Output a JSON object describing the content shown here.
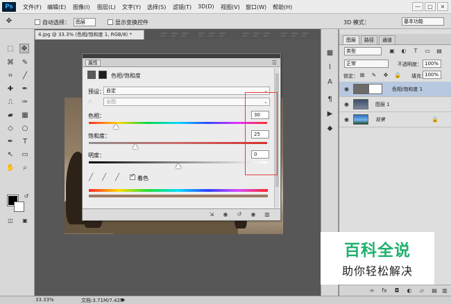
{
  "app": {
    "logo": "Ps",
    "menu": [
      "文件(F)",
      "编辑(E)",
      "图像(I)",
      "图层(L)",
      "文字(Y)",
      "选择(S)",
      "滤镜(T)",
      "3D(D)",
      "视图(V)",
      "窗口(W)",
      "帮助(H)"
    ],
    "window_buttons": [
      "—",
      "□",
      "×"
    ]
  },
  "options": {
    "auto_select_label": "自动选择：",
    "auto_select_value": "图层",
    "transform_label": "显示变换控件",
    "mode_label": "3D 模式：",
    "workspace": "基本功能"
  },
  "document": {
    "tab_title": "4.jpg @ 33.3% (色相/饱和度 1, RGB/8) *"
  },
  "properties_panel": {
    "tab_label": "属性",
    "adjustment_title": "色相/饱和度",
    "preset_label": "预设：",
    "preset_value": "自定",
    "channel_value": "全图",
    "hue_label": "色相：",
    "hue_value": "30",
    "saturation_label": "饱和度：",
    "saturation_value": "25",
    "lightness_label": "明度：",
    "lightness_value": "0",
    "colorize_label": "着色",
    "hue_slider_percent": 0.15,
    "saturation_slider_percent": 0.26,
    "lightness_slider_percent": 0.5
  },
  "layers_panel": {
    "tabs": [
      "图层",
      "路径",
      "通道"
    ],
    "kind": "类型",
    "blend_mode": "正常",
    "opacity_label": "不透明度：",
    "opacity_value": "100%",
    "lock_label": "锁定：",
    "fill_label": "填充：",
    "fill_value": "100%",
    "layers": [
      {
        "name": "色相/饱和度 1"
      },
      {
        "name": "图层 1"
      },
      {
        "name": "背景"
      }
    ]
  },
  "status": {
    "zoom": "33.33%",
    "doc_size": "文档:3.71M/7.42M"
  },
  "watermark": {
    "main": "百科全说",
    "sub": "助你轻松解决"
  },
  "colors": {
    "accent": "#31a8ff",
    "selected_layer": "#b8c8e0",
    "annotation": "#e43b3b",
    "watermark_green": "#20b16d"
  }
}
